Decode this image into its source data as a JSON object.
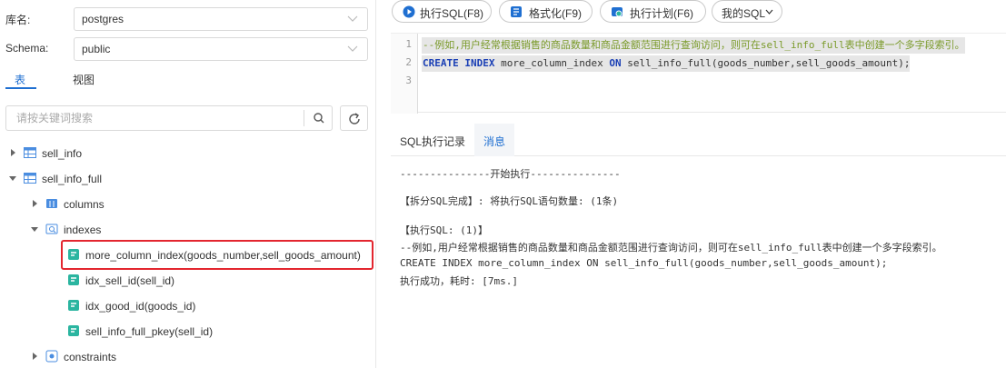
{
  "left": {
    "db_label": "库名:",
    "db_value": "postgres",
    "schema_label": "Schema:",
    "schema_value": "public",
    "tabs": [
      "表",
      "视图"
    ],
    "search_placeholder": "请按关键词搜索",
    "tree": [
      {
        "label": "sell_info",
        "icon": "table-icon"
      },
      {
        "label": "sell_info_full",
        "icon": "table-icon"
      },
      {
        "label": "columns",
        "icon": "columns-icon"
      },
      {
        "label": "indexes",
        "icon": "index-folder-icon"
      },
      {
        "label": "more_column_index(goods_number,sell_goods_amount)",
        "icon": "index-icon"
      },
      {
        "label": "idx_sell_id(sell_id)",
        "icon": "index-icon"
      },
      {
        "label": "idx_good_id(goods_id)",
        "icon": "index-icon"
      },
      {
        "label": "sell_info_full_pkey(sell_id)",
        "icon": "index-icon"
      },
      {
        "label": "constraints",
        "icon": "constraints-icon"
      }
    ]
  },
  "toolbar": {
    "run": "执行SQL(F8)",
    "format": "格式化(F9)",
    "plan": "执行计划(F6)",
    "my_sql": "我的SQL"
  },
  "editor": {
    "line_numbers": [
      "1",
      "2",
      "3"
    ],
    "line1": "--例如,用户经常根据销售的商品数量和商品金额范围进行查询访问，则可在sell_info_full表中创建一个多字段索引。",
    "line2_kw1": "CREATE INDEX",
    "line2_name": " more_column_index ",
    "line2_kw2": "ON",
    "line2_rest": " sell_info_full(goods_number,sell_goods_amount);"
  },
  "output": {
    "tabs": [
      "SQL执行记录",
      "消息"
    ],
    "lines": [
      "---------------开始执行---------------",
      "【拆分SQL完成】: 将执行SQL语句数量: (1条)",
      "【执行SQL: (1)】",
      "--例如,用户经常根据销售的商品数量和商品金额范围进行查询访问，则可在sell_info_full表中创建一个多字段索引。",
      "CREATE INDEX more_column_index ON sell_info_full(goods_number,sell_goods_amount);",
      "执行成功，耗时: [7ms.]"
    ]
  },
  "colors": {
    "accent": "#1f6fd1",
    "highlight": "#e3262f"
  }
}
